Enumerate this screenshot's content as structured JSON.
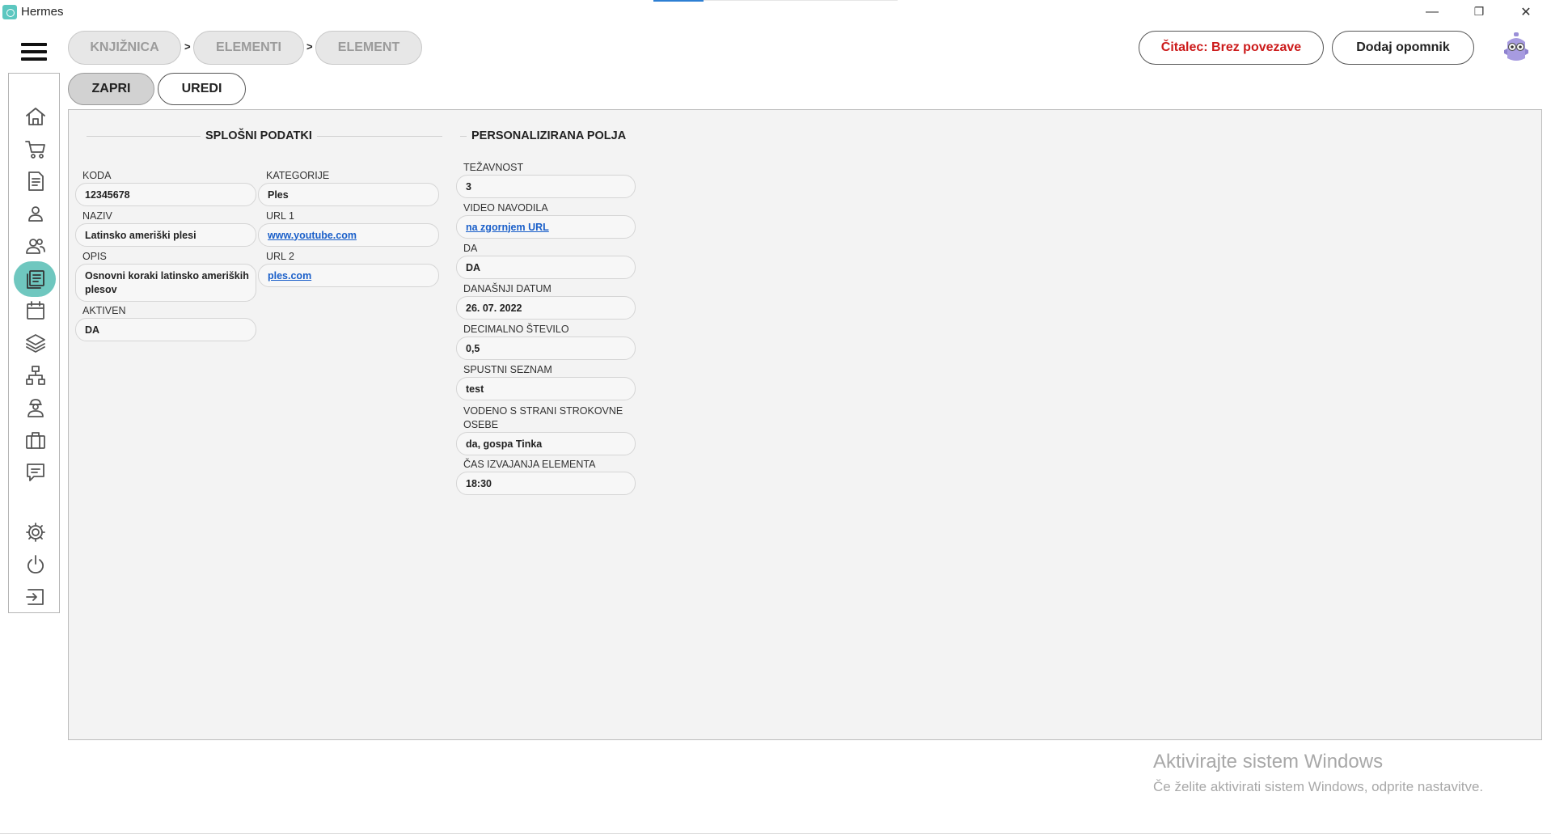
{
  "window": {
    "title": "Hermes",
    "minimize": "—",
    "restore": "❐",
    "close": "✕"
  },
  "breadcrumb": {
    "items": [
      "KNJIŽNICA",
      "ELEMENTI",
      "ELEMENT"
    ],
    "separator": ">"
  },
  "header": {
    "reader_label": "Čitalec: Brez povezave",
    "reminder_label": "Dodaj opomnik"
  },
  "actions": {
    "close_label": "ZAPRI",
    "edit_label": "UREDI"
  },
  "sidebar": {
    "items": [
      {
        "icon": "home-icon"
      },
      {
        "icon": "cart-icon"
      },
      {
        "icon": "document-icon"
      },
      {
        "icon": "user-icon"
      },
      {
        "icon": "users-icon"
      },
      {
        "icon": "library-icon",
        "active": true
      },
      {
        "icon": "calendar-icon"
      },
      {
        "icon": "layers-icon"
      },
      {
        "icon": "sitemap-icon"
      },
      {
        "icon": "worker-icon"
      },
      {
        "icon": "briefcase-icon"
      },
      {
        "icon": "message-icon"
      },
      {
        "icon": "gear-icon"
      },
      {
        "icon": "power-icon"
      },
      {
        "icon": "logout-icon"
      }
    ],
    "active_color": "#6fc7bf"
  },
  "general": {
    "heading": "SPLOŠNI PODATKI",
    "code_label": "KODA",
    "code_value": "12345678",
    "name_label": "NAZIV",
    "name_value": "Latinsko ameriški plesi",
    "desc_label": "OPIS",
    "desc_value": "Osnovni koraki latinsko ameriških plesov",
    "active_label": "AKTIVEN",
    "active_value": "DA",
    "category_label": "KATEGORIJE",
    "category_value": "Ples",
    "url1_label": "URL 1",
    "url1_value": "www.youtube.com",
    "url2_label": "URL 2",
    "url2_value": "ples.com"
  },
  "custom": {
    "heading": "PERSONALIZIRANA POLJA",
    "fields": [
      {
        "label": "TEŽAVNOST",
        "value": "3"
      },
      {
        "label": "VIDEO NAVODILA",
        "value": "na zgornjem URL",
        "link": true
      },
      {
        "label": "DA",
        "value": "DA"
      },
      {
        "label": "DANAŠNJI DATUM",
        "value": "26. 07. 2022"
      },
      {
        "label": "DECIMALNO ŠTEVILO",
        "value": "0,5"
      },
      {
        "label": "SPUSTNI SEZNAM",
        "value": "test"
      },
      {
        "label": "VODENO S STRANI STROKOVNE OSEBE",
        "value": "da, gospa Tinka"
      },
      {
        "label": "ČAS IZVAJANJA ELEMENTA",
        "value": "18:30"
      }
    ]
  },
  "watermark": {
    "line1": "Aktivirajte sistem Windows",
    "line2": "Če želite aktivirati sistem Windows, odprite nastavitve."
  },
  "colors": {
    "accent": "#6fc7bf",
    "reader_status": "#cc1a1a",
    "link": "#1a5fc9"
  }
}
